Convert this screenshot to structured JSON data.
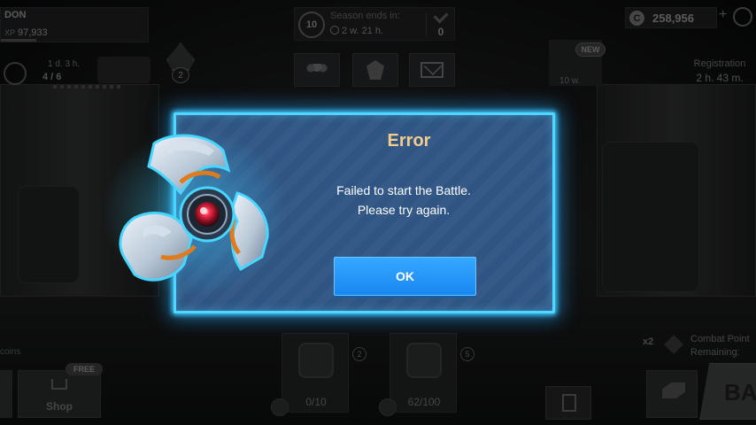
{
  "player": {
    "name": "DON",
    "xp_label": "XP",
    "xp_value": "97,933"
  },
  "season": {
    "rank": "10",
    "label": "Season ends in:",
    "time_left": "2 w. 21 h.",
    "points": "0"
  },
  "currency": {
    "value": "258,956",
    "plus": "+"
  },
  "event": {
    "time_left": "1 d. 3 h.",
    "progress": "4 / 6"
  },
  "league": {
    "number": "2"
  },
  "new_item": {
    "badge": "NEW",
    "duration": "10 w."
  },
  "registration": {
    "label": "Registration",
    "time_left": "2 h. 43 m."
  },
  "bottom": {
    "coins_label": "coins",
    "shop": {
      "badge": "FREE",
      "label": "Shop"
    },
    "crates": [
      {
        "badge": "2",
        "count": "0/10"
      },
      {
        "badge": "5",
        "count": "62/100"
      }
    ],
    "combat": {
      "multiplier": "x2",
      "label": "Combat Point",
      "remaining": "Remaining:"
    },
    "battle_label": "BAT"
  },
  "dialog": {
    "title": "Error",
    "message_line_1": "Failed to start the Battle.",
    "message_line_2": "Please try again.",
    "ok_label": "OK"
  },
  "colors": {
    "dialog_bg": "#2f5584",
    "dialog_border": "#4fd7ff",
    "title": "#f3cc8c",
    "ok_button": "#1f93f8"
  }
}
